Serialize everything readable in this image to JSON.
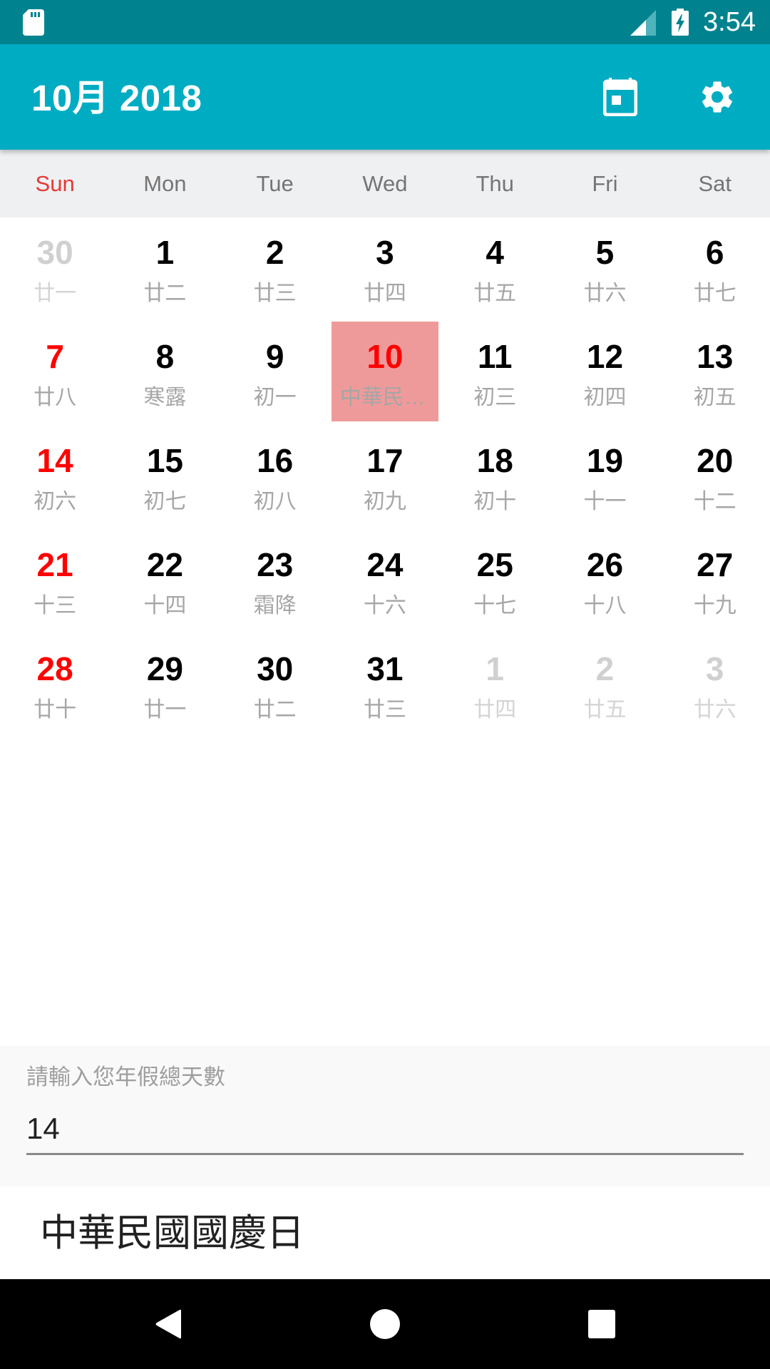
{
  "status_bar": {
    "time": "3:54",
    "icons": [
      "sd-card-icon",
      "signal-icon",
      "battery-charging-icon"
    ]
  },
  "toolbar": {
    "title": "10月 2018",
    "actions": [
      {
        "name": "today-button",
        "icon": "calendar-today-icon"
      },
      {
        "name": "settings-button",
        "icon": "gear-icon"
      }
    ],
    "color": "#00acc1"
  },
  "calendar": {
    "weekdays": [
      "Sun",
      "Mon",
      "Tue",
      "Wed",
      "Thu",
      "Fri",
      "Sat"
    ],
    "selected_day": 10,
    "selected_color": "#ef9a9a",
    "weekend_color": "#ff0000",
    "weeks": [
      [
        {
          "day": "30",
          "lunar": "廿一",
          "other": true
        },
        {
          "day": "1",
          "lunar": "廿二"
        },
        {
          "day": "2",
          "lunar": "廿三"
        },
        {
          "day": "3",
          "lunar": "廿四"
        },
        {
          "day": "4",
          "lunar": "廿五"
        },
        {
          "day": "5",
          "lunar": "廿六"
        },
        {
          "day": "6",
          "lunar": "廿七"
        }
      ],
      [
        {
          "day": "7",
          "lunar": "廿八",
          "weekend": true
        },
        {
          "day": "8",
          "lunar": "寒露"
        },
        {
          "day": "9",
          "lunar": "初一"
        },
        {
          "day": "10",
          "lunar": "中華民國國慶日",
          "holiday": true,
          "selected": true
        },
        {
          "day": "11",
          "lunar": "初三"
        },
        {
          "day": "12",
          "lunar": "初四"
        },
        {
          "day": "13",
          "lunar": "初五"
        }
      ],
      [
        {
          "day": "14",
          "lunar": "初六",
          "weekend": true
        },
        {
          "day": "15",
          "lunar": "初七"
        },
        {
          "day": "16",
          "lunar": "初八"
        },
        {
          "day": "17",
          "lunar": "初九"
        },
        {
          "day": "18",
          "lunar": "初十"
        },
        {
          "day": "19",
          "lunar": "十一"
        },
        {
          "day": "20",
          "lunar": "十二"
        }
      ],
      [
        {
          "day": "21",
          "lunar": "十三",
          "weekend": true
        },
        {
          "day": "22",
          "lunar": "十四"
        },
        {
          "day": "23",
          "lunar": "霜降"
        },
        {
          "day": "24",
          "lunar": "十六"
        },
        {
          "day": "25",
          "lunar": "十七"
        },
        {
          "day": "26",
          "lunar": "十八"
        },
        {
          "day": "27",
          "lunar": "十九"
        }
      ],
      [
        {
          "day": "28",
          "lunar": "廿十",
          "weekend": true
        },
        {
          "day": "29",
          "lunar": "廿一"
        },
        {
          "day": "30",
          "lunar": "廿二"
        },
        {
          "day": "31",
          "lunar": "廿三"
        },
        {
          "day": "1",
          "lunar": "廿四",
          "other": true
        },
        {
          "day": "2",
          "lunar": "廿五",
          "other": true
        },
        {
          "day": "3",
          "lunar": "廿六",
          "other": true
        }
      ]
    ]
  },
  "vacation_input": {
    "label": "請輸入您年假總天數",
    "value": "14"
  },
  "holiday_detail": {
    "name": "中華民國國慶日"
  },
  "nav_bar": {
    "buttons": [
      "back-button",
      "home-button",
      "recents-button"
    ]
  }
}
